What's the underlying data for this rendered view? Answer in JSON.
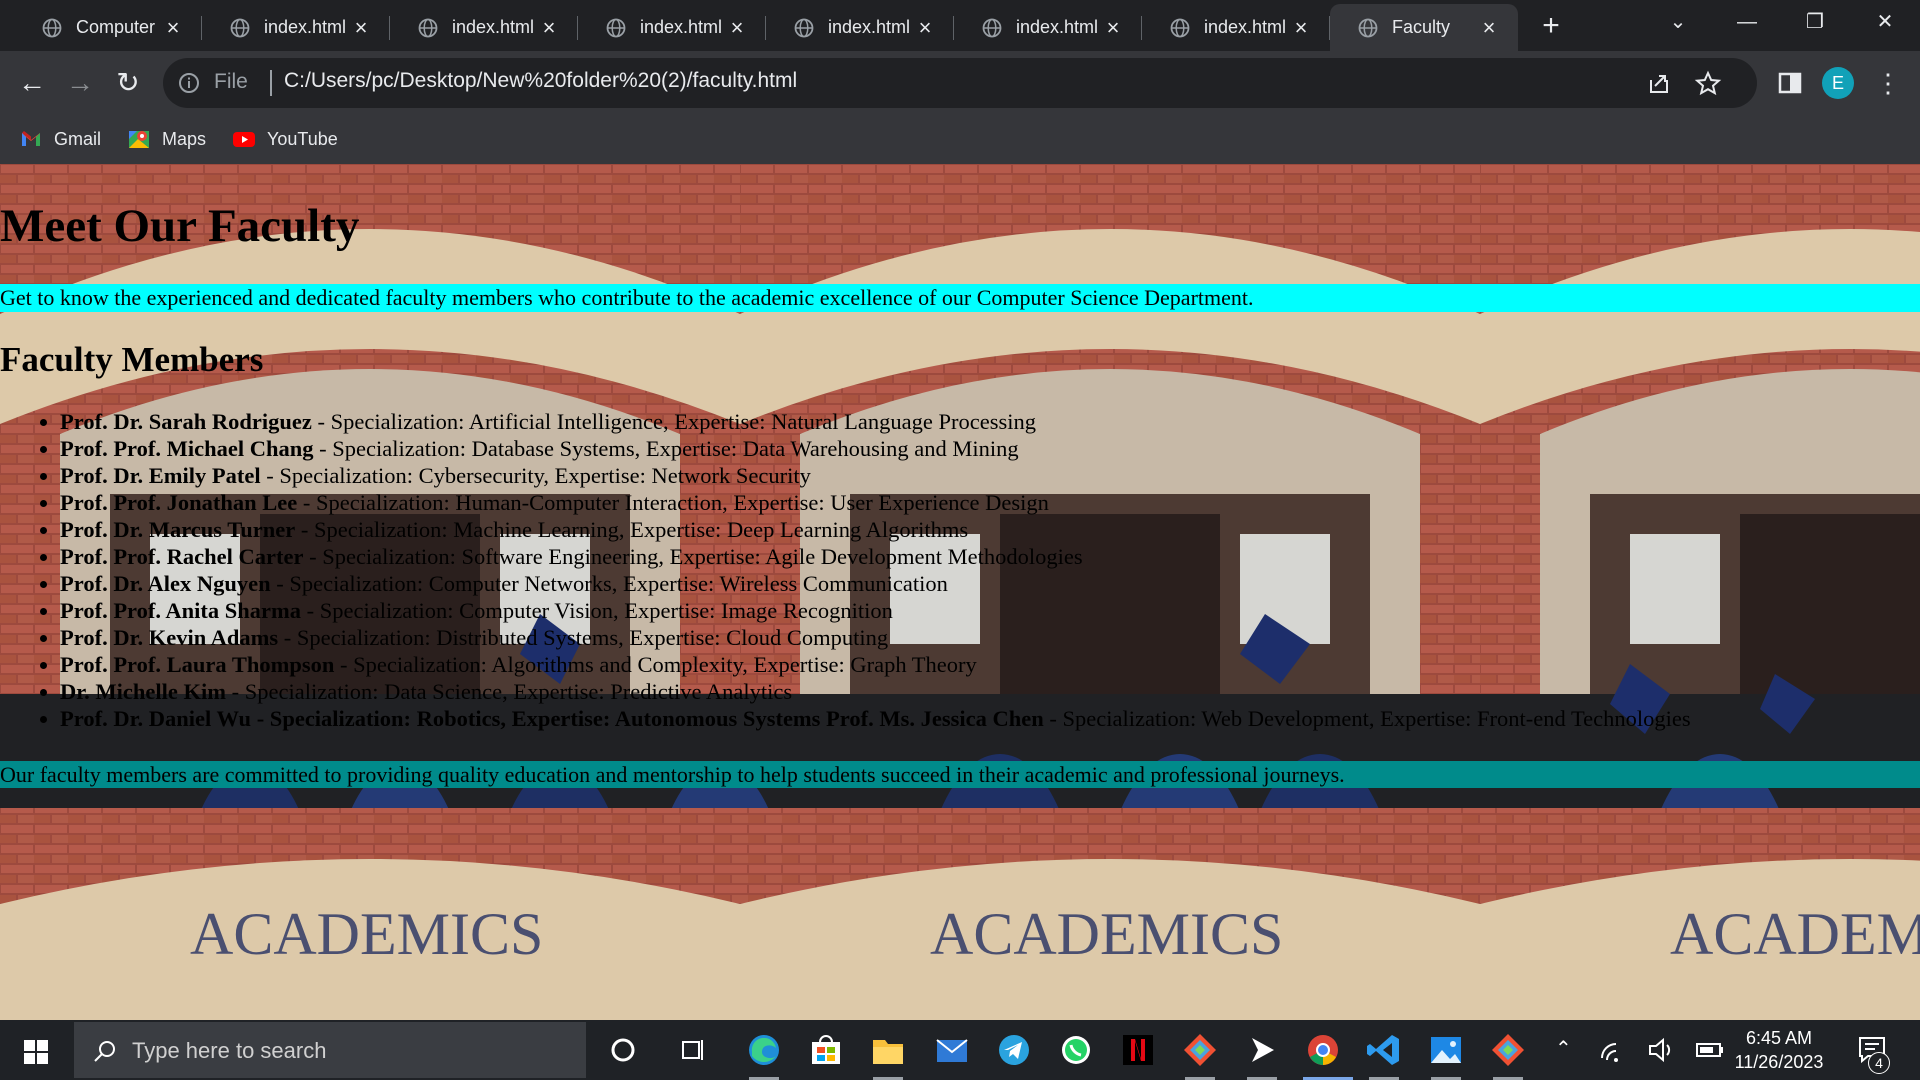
{
  "browser": {
    "tabs": [
      {
        "title": "Computer",
        "active": false
      },
      {
        "title": "index.html",
        "active": false
      },
      {
        "title": "index.html",
        "active": false
      },
      {
        "title": "index.html",
        "active": false
      },
      {
        "title": "index.html",
        "active": false
      },
      {
        "title": "index.html",
        "active": false
      },
      {
        "title": "index.html",
        "active": false
      },
      {
        "title": "Faculty",
        "active": true
      }
    ],
    "new_tab_label": "+",
    "address": {
      "scheme_label": "File",
      "url": "C:/Users/pc/Desktop/New%20folder%20(2)/faculty.html"
    },
    "profile_initial": "E",
    "bookmarks": [
      {
        "label": "Gmail",
        "icon": "gmail-icon"
      },
      {
        "label": "Maps",
        "icon": "maps-icon"
      },
      {
        "label": "YouTube",
        "icon": "youtube-icon"
      }
    ],
    "accent_color": "#11a1b8"
  },
  "page": {
    "title": "Meet Our Faculty",
    "intro": "Get to know the experienced and dedicated faculty members who contribute to the academic excellence of our Computer Science Department.",
    "section_heading": "Faculty Members",
    "faculty": [
      {
        "name": "Prof. Dr. Sarah Rodriguez",
        "details": " - Specialization: Artificial Intelligence, Expertise: Natural Language Processing"
      },
      {
        "name": "Prof. Prof. Michael Chang",
        "details": " - Specialization: Database Systems, Expertise: Data Warehousing and Mining"
      },
      {
        "name": "Prof. Dr. Emily Patel",
        "details": " - Specialization: Cybersecurity, Expertise: Network Security"
      },
      {
        "name": "Prof. Prof. Jonathan Lee",
        "details": " - Specialization: Human-Computer Interaction, Expertise: User Experience Design"
      },
      {
        "name": "Prof. Dr. Marcus Turner",
        "details": " - Specialization: Machine Learning, Expertise: Deep Learning Algorithms"
      },
      {
        "name": "Prof. Prof. Rachel Carter",
        "details": " - Specialization: Software Engineering, Expertise: Agile Development Methodologies"
      },
      {
        "name": "Prof. Dr. Alex Nguyen",
        "details": " - Specialization: Computer Networks, Expertise: Wireless Communication"
      },
      {
        "name": "Prof. Prof. Anita Sharma",
        "details": " - Specialization: Computer Vision, Expertise: Image Recognition"
      },
      {
        "name": "Prof. Dr. Kevin Adams",
        "details": " - Specialization: Distributed Systems, Expertise: Cloud Computing"
      },
      {
        "name": "Prof. Prof. Laura Thompson",
        "details": " - Specialization: Algorithms and Complexity, Expertise: Graph Theory"
      },
      {
        "name": "Dr. Michelle Kim",
        "details": " - Specialization: Data Science, Expertise: Predictive Analytics"
      },
      {
        "name": "Prof. Dr. Daniel Wu - Specialization: Robotics, Expertise: Autonomous Systems Prof. Ms. Jessica Chen",
        "details": " - Specialization: Web Development, Expertise: Front-end Technologies"
      }
    ],
    "closing": "Our faculty members are committed to providing quality education and mentorship to help students succeed in their academic and professional journeys.",
    "background_sign_text": "ACADEMICS",
    "intro_bg_color": "#00ffff",
    "closing_bg_color": "#008b8b"
  },
  "taskbar": {
    "search_placeholder": "Type here to search",
    "time": "6:45 AM",
    "date": "11/26/2023",
    "notification_count": "4",
    "apps": [
      "cortana-icon",
      "task-view-icon",
      "edge-icon",
      "store-icon",
      "file-explorer-icon",
      "mail-icon",
      "telegram-icon",
      "whatsapp-icon",
      "netflix-icon",
      "git-icon",
      "media-player-icon",
      "chrome-icon",
      "vscode-icon",
      "photos-icon",
      "git-icon"
    ]
  }
}
